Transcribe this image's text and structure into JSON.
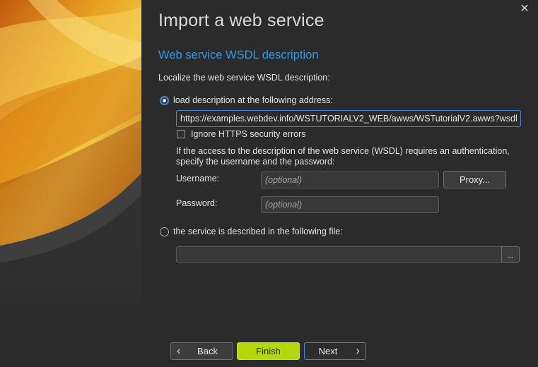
{
  "window": {
    "title": "Import a web service",
    "section_title": "Web service WSDL description",
    "close_glyph": "✕"
  },
  "form": {
    "intro": "Localize the web service WSDL description:",
    "option_address": "load description at the following address:",
    "address_value": "https://examples.webdev.info/WSTUTORIALV2_WEB/awws/WSTutorialV2.awws?wsdl",
    "ignore_https_label": "Ignore HTTPS security errors",
    "auth_note_line1": "If the access to the description of the web service (WSDL) requires an authentication,",
    "auth_note_line2": "specify the username and the password:",
    "username_label": "Username:",
    "username_placeholder": "(optional)",
    "password_label": "Password:",
    "password_placeholder": "(optional)",
    "proxy_button": "Proxy...",
    "option_file": "the service is described in the following file:",
    "file_value": "",
    "browse_button": "..."
  },
  "footer": {
    "back": "Back",
    "finish": "Finish",
    "next": "Next"
  },
  "colors": {
    "accent": "#2f9be6",
    "finish": "#b4d80a",
    "background": "#2b2b2b"
  },
  "icons": [
    "close-icon",
    "chevron-left-icon",
    "chevron-right-icon"
  ]
}
